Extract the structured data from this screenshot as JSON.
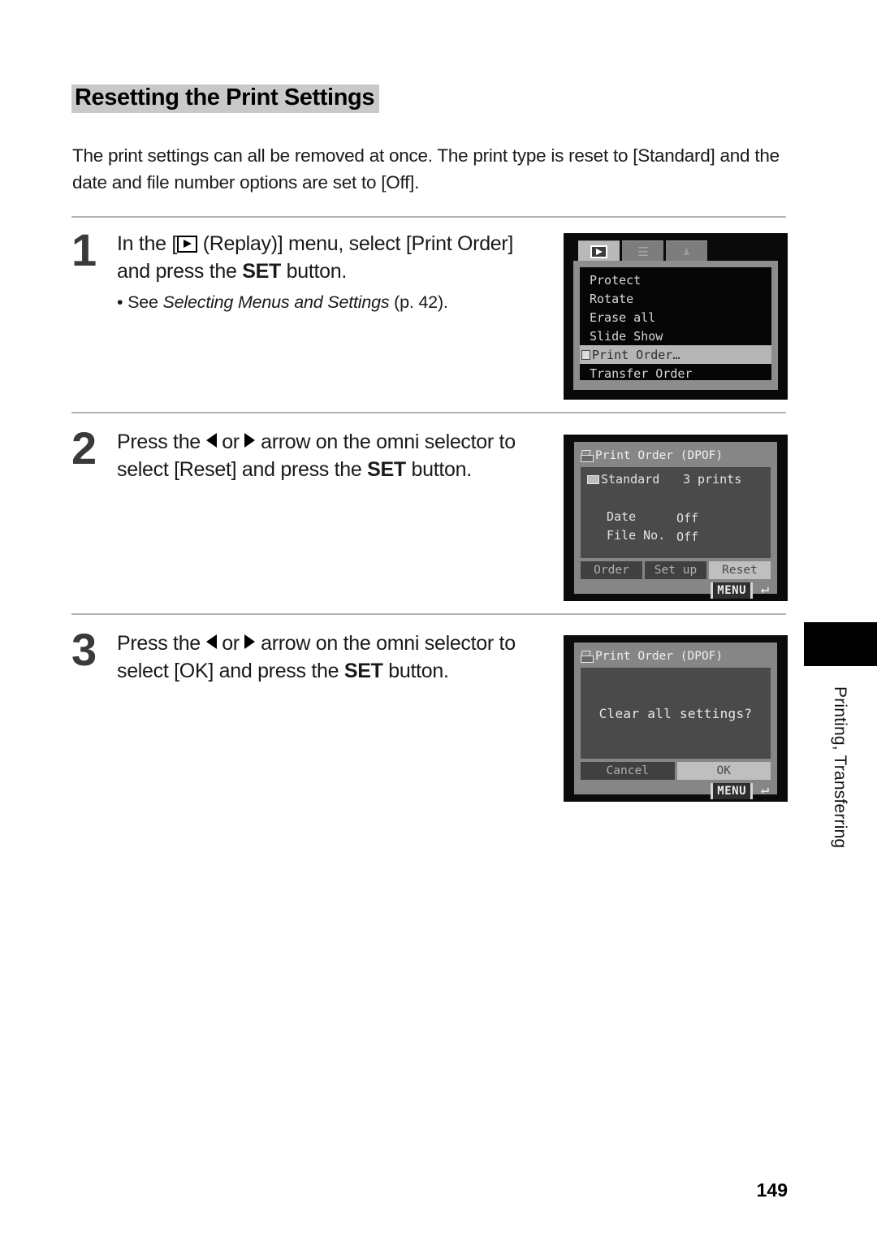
{
  "page": {
    "title": "Resetting the Print Settings",
    "intro": "The print settings can all be removed at once. The print type is reset to [Standard] and the date and file number options are set to [Off].",
    "page_number": "149",
    "edge_tab_label": "Printing, Transferring"
  },
  "steps": [
    {
      "number": "1",
      "text_before_icon": "In the [",
      "icon": "replay-icon",
      "text_after_icon": " (Replay)] menu, select [Print Order] and press the ",
      "bold": "SET",
      "text_end": " button.",
      "bullet_prefix": "• See ",
      "bullet_italic": "Selecting Menus and Settings",
      "bullet_suffix": " (p. 42)."
    },
    {
      "number": "2",
      "lead": "Press the ",
      "mid": " or ",
      "after_arrows": " arrow on the omni selector to select [Reset] and press the ",
      "bold": "SET",
      "text_end": " button."
    },
    {
      "number": "3",
      "lead": "Press the ",
      "mid": " or ",
      "after_arrows": " arrow on the omni selector to select [OK] and press the ",
      "bold": "SET",
      "text_end": " button."
    }
  ],
  "screens": {
    "replay_menu": {
      "tabs": [
        {
          "name": "replay-tab",
          "icon": "play-triangle-icon",
          "active": true
        },
        {
          "name": "setup-tab",
          "icon": "tools-icon",
          "glyph": "\u0001"
        },
        {
          "name": "my-camera-tab",
          "icon": "my-camera-icon",
          "glyph": "\u0001"
        }
      ],
      "items": [
        {
          "label": "Protect",
          "selected": false,
          "icon": null
        },
        {
          "label": "Rotate",
          "selected": false,
          "icon": null
        },
        {
          "label": "Erase all",
          "selected": false,
          "icon": null
        },
        {
          "label": "Slide Show",
          "selected": false,
          "icon": null
        },
        {
          "label": "Print Order…",
          "selected": true,
          "icon": "printer-icon"
        },
        {
          "label": "Transfer Order",
          "selected": false,
          "icon": null
        }
      ]
    },
    "print_order": {
      "title": "Print Order (DPOF)",
      "type_label": "Standard",
      "type_count": "3 prints",
      "rows": [
        {
          "key": "Date",
          "value": "Off"
        },
        {
          "key": "File No.",
          "value": "Off"
        }
      ],
      "buttons": [
        {
          "label": "Order",
          "selected": false
        },
        {
          "label": "Set up",
          "selected": false
        },
        {
          "label": "Reset",
          "selected": true
        }
      ],
      "menu_badge": "MENU",
      "return_glyph": "↵"
    },
    "confirm_dialog": {
      "title": "Print Order (DPOF)",
      "prompt": "Clear all settings?",
      "buttons": [
        {
          "label": "Cancel",
          "selected": false
        },
        {
          "label": "OK",
          "selected": true
        }
      ],
      "menu_badge": "MENU",
      "return_glyph": "↵"
    }
  },
  "colors": {
    "title_highlight": "#c9c9c9",
    "rule": "#b3b3b3",
    "step_number": "#3a3a3a",
    "lcd_panel": "#868686",
    "lcd_body": "#4a4a4a",
    "lcd_selected": "#bfbfbf"
  }
}
